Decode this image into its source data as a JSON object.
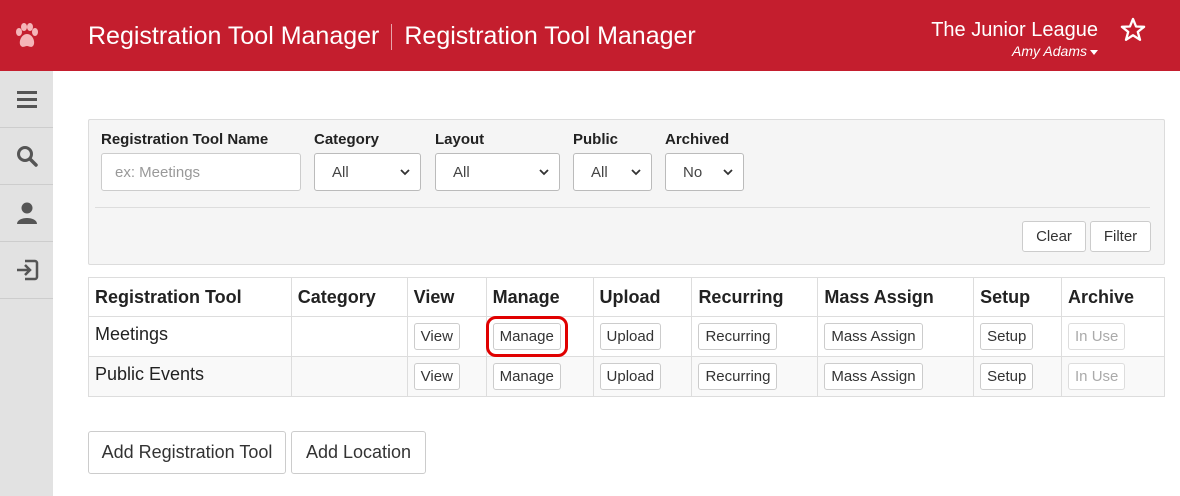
{
  "header": {
    "title_primary": "Registration Tool Manager",
    "title_secondary": "Registration Tool Manager",
    "org_name": "The Junior League",
    "user_name": "Amy Adams",
    "brand_color": "#c41e2e",
    "logo_icon": "paw-icon",
    "favorite_icon": "star-icon"
  },
  "sidebar": {
    "items": [
      {
        "icon": "menu-icon"
      },
      {
        "icon": "search-icon"
      },
      {
        "icon": "user-icon"
      },
      {
        "icon": "sign-in-icon"
      }
    ]
  },
  "filters": {
    "name_label": "Registration Tool Name",
    "name_placeholder": "ex: Meetings",
    "category_label": "Category",
    "category_value": "All",
    "layout_label": "Layout",
    "layout_value": "All",
    "public_label": "Public",
    "public_value": "All",
    "archived_label": "Archived",
    "archived_value": "No",
    "clear_label": "Clear",
    "filter_label": "Filter"
  },
  "table": {
    "columns": [
      "Registration Tool",
      "Category",
      "View",
      "Manage",
      "Upload",
      "Recurring",
      "Mass Assign",
      "Setup",
      "Archive"
    ],
    "rows": [
      {
        "name": "Meetings",
        "category": "",
        "view": "View",
        "manage": "Manage",
        "upload": "Upload",
        "recurring": "Recurring",
        "mass_assign": "Mass Assign",
        "setup": "Setup",
        "archive": "In Use"
      },
      {
        "name": "Public Events",
        "category": "",
        "view": "View",
        "manage": "Manage",
        "upload": "Upload",
        "recurring": "Recurring",
        "mass_assign": "Mass Assign",
        "setup": "Setup",
        "archive": "In Use"
      }
    ]
  },
  "actions": {
    "add_tool_label": "Add Registration Tool",
    "add_location_label": "Add Location"
  },
  "highlight_color": "#e00000"
}
